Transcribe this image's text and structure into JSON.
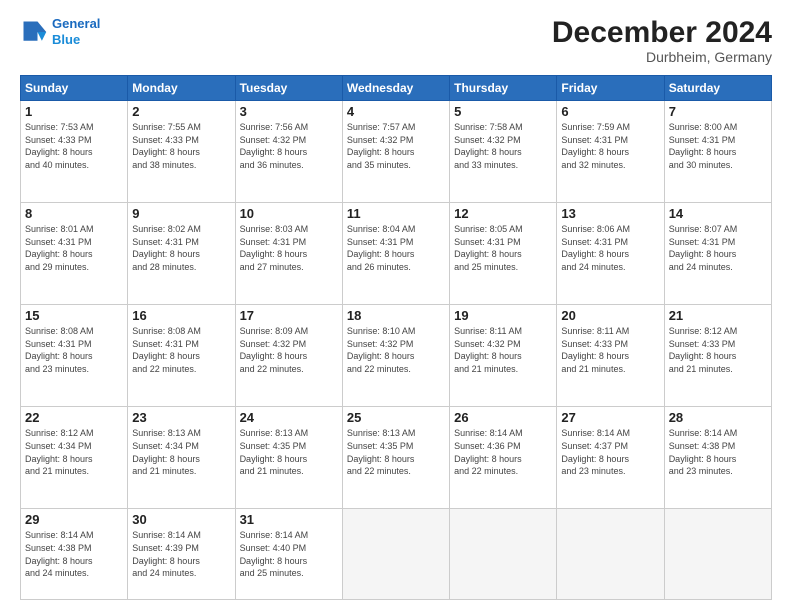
{
  "header": {
    "logo_line1": "General",
    "logo_line2": "Blue",
    "month": "December 2024",
    "location": "Durbheim, Germany"
  },
  "days_of_week": [
    "Sunday",
    "Monday",
    "Tuesday",
    "Wednesday",
    "Thursday",
    "Friday",
    "Saturday"
  ],
  "weeks": [
    [
      {
        "day": "1",
        "info": "Sunrise: 7:53 AM\nSunset: 4:33 PM\nDaylight: 8 hours\nand 40 minutes."
      },
      {
        "day": "2",
        "info": "Sunrise: 7:55 AM\nSunset: 4:33 PM\nDaylight: 8 hours\nand 38 minutes."
      },
      {
        "day": "3",
        "info": "Sunrise: 7:56 AM\nSunset: 4:32 PM\nDaylight: 8 hours\nand 36 minutes."
      },
      {
        "day": "4",
        "info": "Sunrise: 7:57 AM\nSunset: 4:32 PM\nDaylight: 8 hours\nand 35 minutes."
      },
      {
        "day": "5",
        "info": "Sunrise: 7:58 AM\nSunset: 4:32 PM\nDaylight: 8 hours\nand 33 minutes."
      },
      {
        "day": "6",
        "info": "Sunrise: 7:59 AM\nSunset: 4:31 PM\nDaylight: 8 hours\nand 32 minutes."
      },
      {
        "day": "7",
        "info": "Sunrise: 8:00 AM\nSunset: 4:31 PM\nDaylight: 8 hours\nand 30 minutes."
      }
    ],
    [
      {
        "day": "8",
        "info": "Sunrise: 8:01 AM\nSunset: 4:31 PM\nDaylight: 8 hours\nand 29 minutes."
      },
      {
        "day": "9",
        "info": "Sunrise: 8:02 AM\nSunset: 4:31 PM\nDaylight: 8 hours\nand 28 minutes."
      },
      {
        "day": "10",
        "info": "Sunrise: 8:03 AM\nSunset: 4:31 PM\nDaylight: 8 hours\nand 27 minutes."
      },
      {
        "day": "11",
        "info": "Sunrise: 8:04 AM\nSunset: 4:31 PM\nDaylight: 8 hours\nand 26 minutes."
      },
      {
        "day": "12",
        "info": "Sunrise: 8:05 AM\nSunset: 4:31 PM\nDaylight: 8 hours\nand 25 minutes."
      },
      {
        "day": "13",
        "info": "Sunrise: 8:06 AM\nSunset: 4:31 PM\nDaylight: 8 hours\nand 24 minutes."
      },
      {
        "day": "14",
        "info": "Sunrise: 8:07 AM\nSunset: 4:31 PM\nDaylight: 8 hours\nand 24 minutes."
      }
    ],
    [
      {
        "day": "15",
        "info": "Sunrise: 8:08 AM\nSunset: 4:31 PM\nDaylight: 8 hours\nand 23 minutes."
      },
      {
        "day": "16",
        "info": "Sunrise: 8:08 AM\nSunset: 4:31 PM\nDaylight: 8 hours\nand 22 minutes."
      },
      {
        "day": "17",
        "info": "Sunrise: 8:09 AM\nSunset: 4:32 PM\nDaylight: 8 hours\nand 22 minutes."
      },
      {
        "day": "18",
        "info": "Sunrise: 8:10 AM\nSunset: 4:32 PM\nDaylight: 8 hours\nand 22 minutes."
      },
      {
        "day": "19",
        "info": "Sunrise: 8:11 AM\nSunset: 4:32 PM\nDaylight: 8 hours\nand 21 minutes."
      },
      {
        "day": "20",
        "info": "Sunrise: 8:11 AM\nSunset: 4:33 PM\nDaylight: 8 hours\nand 21 minutes."
      },
      {
        "day": "21",
        "info": "Sunrise: 8:12 AM\nSunset: 4:33 PM\nDaylight: 8 hours\nand 21 minutes."
      }
    ],
    [
      {
        "day": "22",
        "info": "Sunrise: 8:12 AM\nSunset: 4:34 PM\nDaylight: 8 hours\nand 21 minutes."
      },
      {
        "day": "23",
        "info": "Sunrise: 8:13 AM\nSunset: 4:34 PM\nDaylight: 8 hours\nand 21 minutes."
      },
      {
        "day": "24",
        "info": "Sunrise: 8:13 AM\nSunset: 4:35 PM\nDaylight: 8 hours\nand 21 minutes."
      },
      {
        "day": "25",
        "info": "Sunrise: 8:13 AM\nSunset: 4:35 PM\nDaylight: 8 hours\nand 22 minutes."
      },
      {
        "day": "26",
        "info": "Sunrise: 8:14 AM\nSunset: 4:36 PM\nDaylight: 8 hours\nand 22 minutes."
      },
      {
        "day": "27",
        "info": "Sunrise: 8:14 AM\nSunset: 4:37 PM\nDaylight: 8 hours\nand 23 minutes."
      },
      {
        "day": "28",
        "info": "Sunrise: 8:14 AM\nSunset: 4:38 PM\nDaylight: 8 hours\nand 23 minutes."
      }
    ],
    [
      {
        "day": "29",
        "info": "Sunrise: 8:14 AM\nSunset: 4:38 PM\nDaylight: 8 hours\nand 24 minutes."
      },
      {
        "day": "30",
        "info": "Sunrise: 8:14 AM\nSunset: 4:39 PM\nDaylight: 8 hours\nand 24 minutes."
      },
      {
        "day": "31",
        "info": "Sunrise: 8:14 AM\nSunset: 4:40 PM\nDaylight: 8 hours\nand 25 minutes."
      },
      {
        "day": "",
        "info": ""
      },
      {
        "day": "",
        "info": ""
      },
      {
        "day": "",
        "info": ""
      },
      {
        "day": "",
        "info": ""
      }
    ]
  ]
}
